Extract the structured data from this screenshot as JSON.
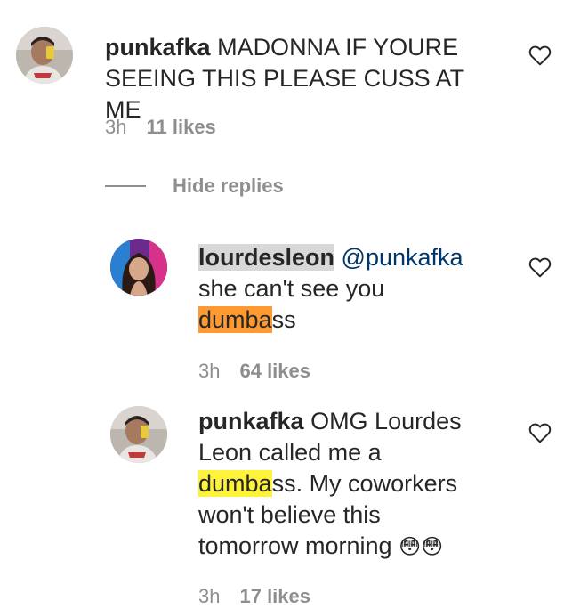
{
  "comments": [
    {
      "username": "punkafka",
      "text": "MADONNA IF YOURE SEEING THIS PLEASE CUSS AT ME",
      "time": "3h",
      "likes": "11 likes"
    }
  ],
  "replies_toggle": {
    "label": "Hide replies"
  },
  "replies": [
    {
      "username": "lourdesleon",
      "mention": "@punkafka",
      "line1": "she can't see you",
      "hl": "dumba",
      "rest": "ss",
      "time": "3h",
      "likes": "64 likes"
    },
    {
      "username": "punkafka",
      "text1": "OMG Lourdes",
      "text2": "Leon called me a",
      "hl": "dumba",
      "text3": "ss. My coworkers",
      "text4": "won't believe this",
      "text5": "tomorrow morning",
      "emoji": "😳😳",
      "time": "3h",
      "likes": "17 likes"
    }
  ],
  "colors": {
    "highlight_orange": "#ff9a33",
    "highlight_yellow": "#fff23a",
    "mention": "#00376b",
    "meta": "#8e8e8e"
  },
  "icons": [
    "heart-icon",
    "avatar"
  ]
}
